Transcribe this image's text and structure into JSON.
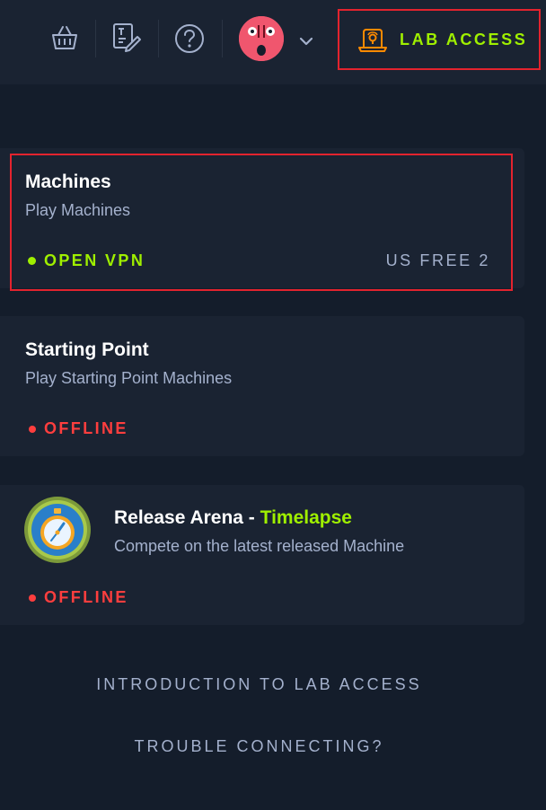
{
  "header": {
    "icons": [
      "basket-icon",
      "edit-document-icon",
      "help-icon",
      "chevron-down-icon",
      "vpn-laptop-icon"
    ],
    "lab_access_label": "LAB ACCESS"
  },
  "colors": {
    "accent_green": "#9fef00",
    "offline_red": "#ff3e3e",
    "highlight_border": "#e3232e",
    "card_bg": "#1a2332",
    "page_bg": "#141d2b"
  },
  "cards": {
    "machines": {
      "title": "Machines",
      "subtitle": "Play Machines",
      "status": "OPEN VPN",
      "server": "US FREE 2"
    },
    "starting_point": {
      "title": "Starting Point",
      "subtitle": "Play Starting Point Machines",
      "status": "OFFLINE"
    },
    "release_arena": {
      "title_prefix": "Release Arena - ",
      "title_highlight": "Timelapse",
      "subtitle": "Compete on the latest released Machine",
      "status": "OFFLINE"
    }
  },
  "footer": {
    "intro_link": "INTRODUCTION TO LAB ACCESS",
    "trouble_link": "TROUBLE CONNECTING?"
  }
}
